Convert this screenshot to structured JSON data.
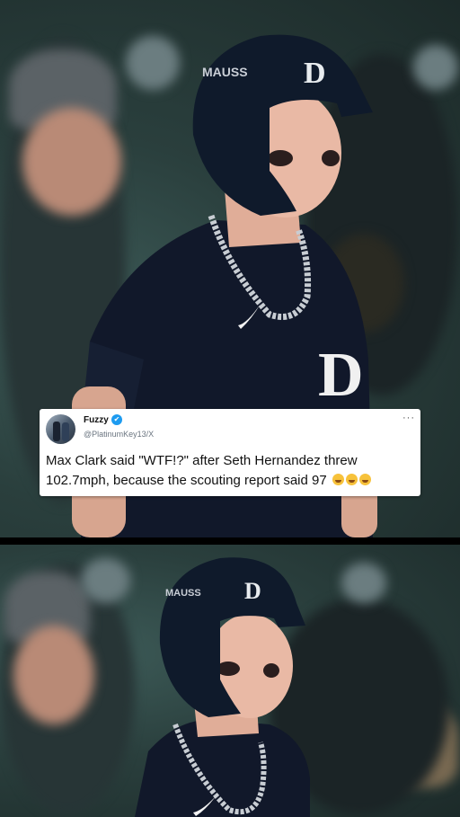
{
  "tweet": {
    "display_name": "Fuzzy",
    "verified_mark": "✔",
    "handle": "@PlatinumKey13/X",
    "more": "···",
    "text": "Max Clark said \"WTF!?\" after Seth Hernandez threw 102.7mph, because the scouting report said 97",
    "emoji_count": 3,
    "emoji_name": "tears-of-joy-emoji"
  },
  "photo": {
    "helmet_text": "MAUSS",
    "jersey_logo_text": "D"
  },
  "colors": {
    "stadium_teal": "#2a3f3d",
    "helmet_navy": "#0f1a2b",
    "jersey_navy": "#11182a",
    "skin": "#e9b9a5",
    "chain_silver": "#c8cdd3",
    "verified_blue": "#1d9bf0"
  }
}
